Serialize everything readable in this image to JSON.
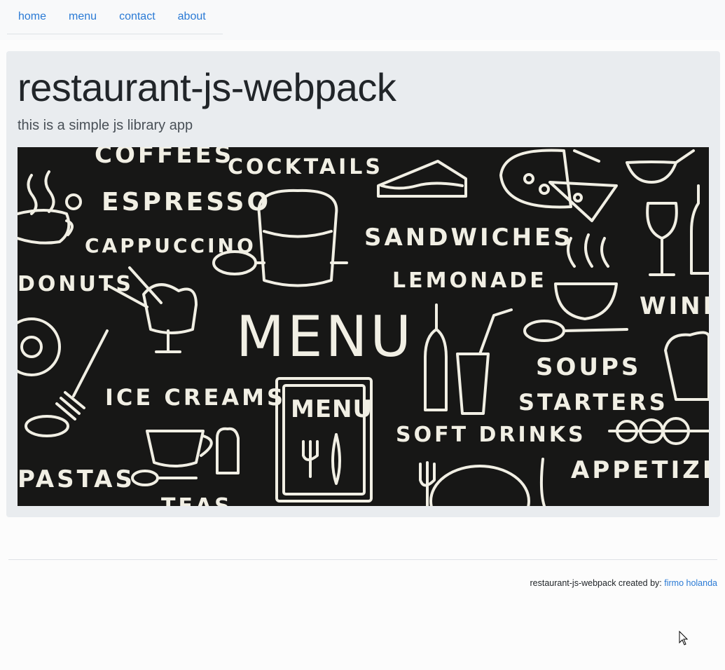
{
  "nav": {
    "items": [
      {
        "label": "home"
      },
      {
        "label": "menu"
      },
      {
        "label": "contact"
      },
      {
        "label": "about"
      }
    ]
  },
  "hero": {
    "title": "restaurant-js-webpack",
    "lead": "this is a simple js library app",
    "image": {
      "words": [
        "COFFEES",
        "COCKTAILS",
        "ESPRESSO",
        "CAPPUCCINO",
        "SANDWICHES",
        "LEMONADE",
        "DONUTS",
        "MENU",
        "WINE",
        "ICE CREAMS",
        "MENU",
        "SOUPS",
        "STARTERS",
        "SOFT DRINKS",
        "PASTAS",
        "APPETIZER",
        "TEAS"
      ]
    }
  },
  "footer": {
    "text": "restaurant-js-webpack created by: ",
    "author_link": "firmo holanda"
  },
  "colors": {
    "link": "#2a7ad5",
    "jumbotron_bg": "#e9ecef",
    "chalkboard": "#171716",
    "chalk": "#f1efe4"
  }
}
